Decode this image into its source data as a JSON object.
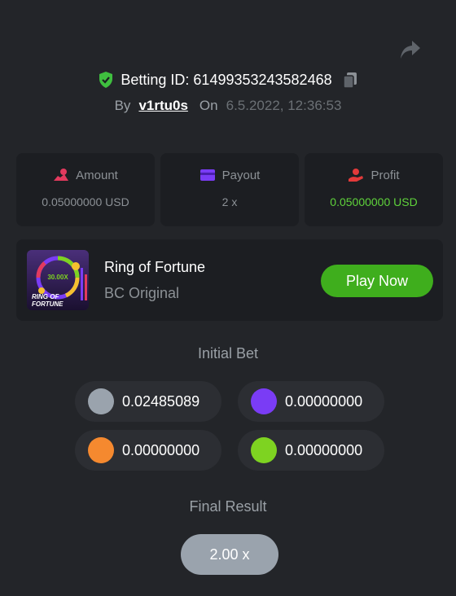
{
  "header": {
    "betting_id_label": "Betting ID: 6149935324358246​8",
    "by_label": "By",
    "username": "v1rtu0s",
    "on_label": "On",
    "date": "6.5.2022, 12:36:53"
  },
  "stats": {
    "amount_label": "Amount",
    "amount_value": "0.05000000 USD",
    "payout_label": "Payout",
    "payout_value": "2 x",
    "profit_label": "Profit",
    "profit_value": "0.05000000 USD"
  },
  "game": {
    "title": "Ring of Fortune",
    "subtitle": "BC Original",
    "play_label": "Play Now",
    "thumb_multiplier": "30.00X",
    "thumb_line1": "RING OF",
    "thumb_line2": "FORTUNE"
  },
  "initial_bet": {
    "title": "Initial Bet",
    "bets": [
      {
        "color": "#9aa3ad",
        "value": "0.02485089"
      },
      {
        "color": "#7a3cf5",
        "value": "0.00000000"
      },
      {
        "color": "#f5892f",
        "value": "0.00000000"
      },
      {
        "color": "#7ed321",
        "value": "0.00000000"
      }
    ]
  },
  "final_result": {
    "title": "Final Result",
    "value": "2.00 x"
  },
  "colors": {
    "background": "#232529",
    "card": "#1c1e22",
    "accent_green": "#3fae1d",
    "profit_green": "#5fd33b"
  }
}
